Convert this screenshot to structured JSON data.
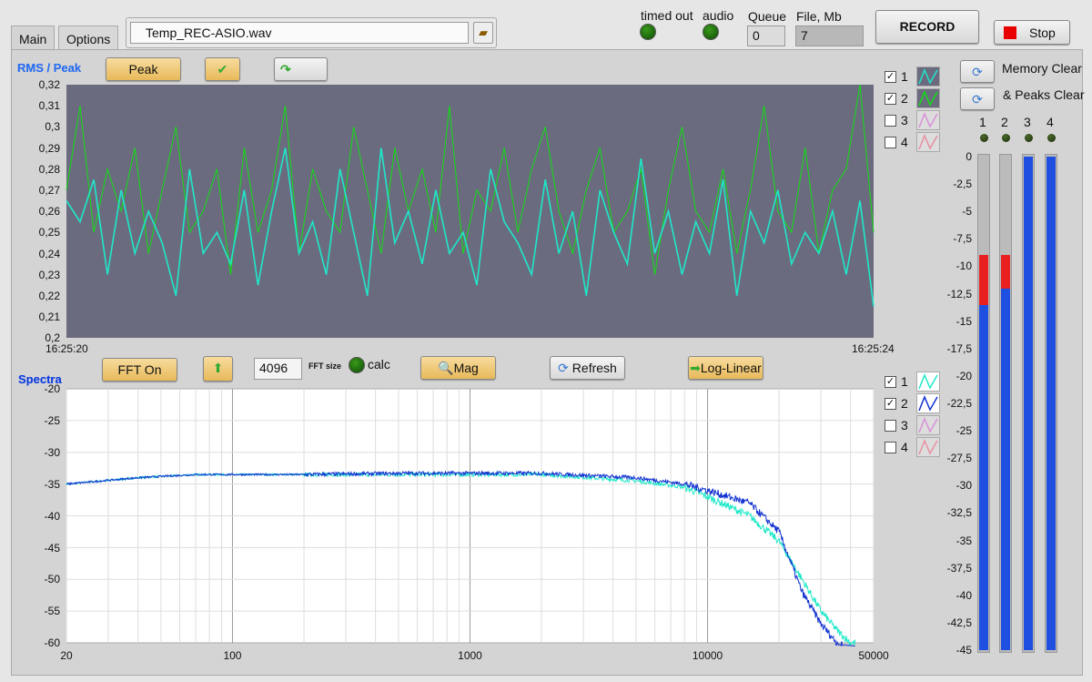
{
  "tabs": [
    {
      "label": "Main",
      "active": true
    },
    {
      "label": "Options",
      "active": false
    }
  ],
  "file_path": {
    "value": "Temp_REC-ASIO.wav"
  },
  "indicators": {
    "timed_out": "timed out",
    "audio": "audio",
    "queue_label": "Queue",
    "queue_value": "0",
    "file_label": "File, Mb",
    "file_value": "7"
  },
  "buttons": {
    "record": "RECORD",
    "stop": "Stop",
    "peak": "Peak",
    "fft_on": "FFT On",
    "mag": "Mag",
    "refresh": "Refresh",
    "log_linear": "Log-Linear",
    "memory_clear": "Memory Clear",
    "peaks_clear": "& Peaks Clear"
  },
  "fft": {
    "size": "4096",
    "size_label": "FFT size",
    "calc_label": "calc"
  },
  "rms_chart": {
    "title": "RMS / Peak",
    "type": "line",
    "ylim": [
      0.2,
      0.32
    ],
    "yticks": [
      "0,32",
      "0,31",
      "0,3",
      "0,29",
      "0,28",
      "0,27",
      "0,26",
      "0,25",
      "0,24",
      "0,23",
      "0,22",
      "0,21",
      "0,2"
    ],
    "xstart": "16:25:20",
    "xend": "16:25:24",
    "legend": [
      {
        "label": "1",
        "checked": true,
        "color": "#1ee8c8"
      },
      {
        "label": "2",
        "checked": true,
        "color": "#10e010"
      },
      {
        "label": "3",
        "checked": false,
        "color": "#d890d8"
      },
      {
        "label": "4",
        "checked": false,
        "color": "#e890a0"
      }
    ],
    "background": "#6b6b80"
  },
  "chart_data": [
    {
      "type": "line",
      "title": "RMS / Peak",
      "ylim": [
        0.2,
        0.32
      ],
      "x_range": [
        "16:25:20",
        "16:25:24"
      ],
      "series": [
        {
          "name": "1",
          "values": [
            0.265,
            0.255,
            0.275,
            0.23,
            0.27,
            0.24,
            0.26,
            0.245,
            0.22,
            0.28,
            0.24,
            0.25,
            0.235,
            0.27,
            0.225,
            0.26,
            0.29,
            0.24,
            0.255,
            0.23,
            0.28,
            0.25,
            0.22,
            0.29,
            0.245,
            0.26,
            0.235,
            0.27,
            0.24,
            0.25,
            0.225,
            0.28,
            0.255,
            0.245,
            0.23,
            0.275,
            0.24,
            0.26,
            0.22,
            0.27,
            0.25,
            0.235,
            0.285,
            0.24,
            0.26,
            0.23,
            0.255,
            0.24,
            0.275,
            0.22,
            0.26,
            0.245,
            0.27,
            0.235,
            0.25,
            0.24,
            0.26,
            0.23,
            0.265,
            0.215
          ]
        },
        {
          "name": "2",
          "values": [
            0.27,
            0.31,
            0.25,
            0.28,
            0.26,
            0.29,
            0.24,
            0.27,
            0.3,
            0.25,
            0.26,
            0.28,
            0.23,
            0.29,
            0.25,
            0.27,
            0.31,
            0.24,
            0.28,
            0.26,
            0.25,
            0.3,
            0.27,
            0.24,
            0.29,
            0.26,
            0.28,
            0.25,
            0.31,
            0.24,
            0.27,
            0.26,
            0.29,
            0.25,
            0.28,
            0.3,
            0.26,
            0.24,
            0.27,
            0.29,
            0.25,
            0.26,
            0.28,
            0.23,
            0.27,
            0.3,
            0.26,
            0.25,
            0.28,
            0.24,
            0.27,
            0.31,
            0.26,
            0.25,
            0.29,
            0.24,
            0.27,
            0.28,
            0.32,
            0.25
          ]
        }
      ]
    },
    {
      "type": "line",
      "title": "Spectra",
      "xscale": "log",
      "xlim": [
        20,
        50000
      ],
      "ylim": [
        -60,
        -20
      ],
      "xticks": [
        "20",
        "100",
        "1000",
        "10000",
        "50000"
      ],
      "yticks": [
        "-20",
        "-25",
        "-30",
        "-35",
        "-40",
        "-45",
        "-50",
        "-55",
        "-60"
      ],
      "x": [
        20,
        40,
        70,
        100,
        200,
        500,
        1000,
        2000,
        5000,
        8000,
        10000,
        15000,
        20000,
        25000,
        30000,
        35000,
        40000
      ],
      "series": [
        {
          "name": "1",
          "values": [
            -35,
            -34,
            -33.5,
            -33.5,
            -33.5,
            -33.5,
            -33.5,
            -33.5,
            -34.5,
            -35.5,
            -37,
            -40,
            -44,
            -50,
            -55,
            -58,
            -60
          ]
        },
        {
          "name": "2",
          "values": [
            -35,
            -34,
            -33.5,
            -33.5,
            -33.5,
            -33.3,
            -33.3,
            -33.3,
            -34,
            -35,
            -36,
            -38,
            -42.5,
            -52,
            -57,
            -60,
            -61
          ]
        }
      ]
    }
  ],
  "spectra_chart": {
    "title": "Spectra",
    "yticks": [
      "-20",
      "-25",
      "-30",
      "-35",
      "-40",
      "-45",
      "-50",
      "-55",
      "-60"
    ],
    "xticks": [
      "20",
      "100",
      "1000",
      "10000",
      "50000"
    ],
    "legend": [
      {
        "label": "1",
        "checked": true,
        "color": "#1ee8c8"
      },
      {
        "label": "2",
        "checked": true,
        "color": "#1030d0"
      },
      {
        "label": "3",
        "checked": false,
        "color": "#d890d8"
      },
      {
        "label": "4",
        "checked": false,
        "color": "#e890a0"
      }
    ]
  },
  "meters": {
    "channels": [
      "1",
      "2",
      "3",
      "4"
    ],
    "scale": [
      "0",
      "-2,5",
      "-5",
      "-7,5",
      "-10",
      "-12,5",
      "-15",
      "-17,5",
      "-20",
      "-22,5",
      "-25",
      "-27,5",
      "-30",
      "-32,5",
      "-35",
      "-37,5",
      "-40",
      "-42,5",
      "-45"
    ],
    "levels_db": [
      -13.5,
      -12,
      0,
      0
    ],
    "peaks_db": [
      -9,
      -9,
      0,
      0
    ]
  }
}
